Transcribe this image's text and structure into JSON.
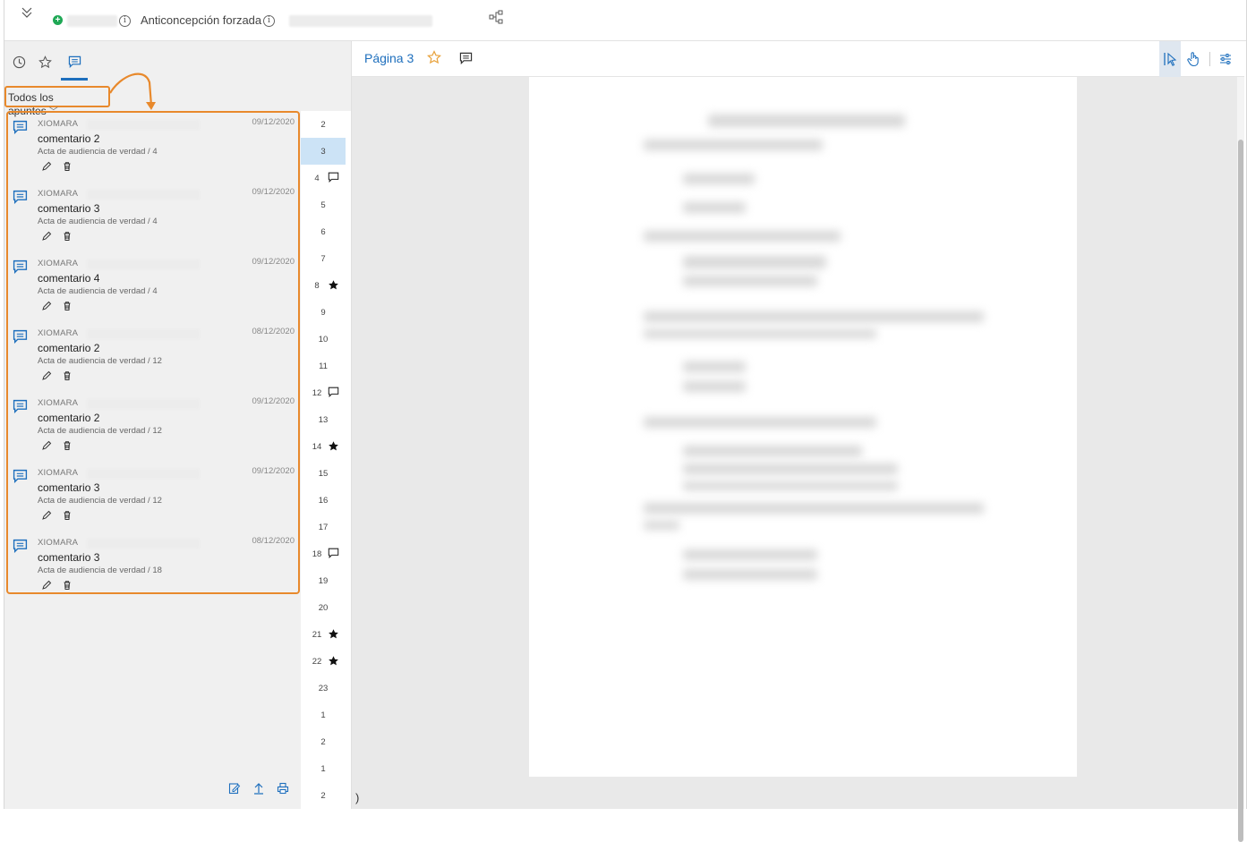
{
  "header": {
    "case_title": "Anticoncepción forzada",
    "icons": [
      "chevron-double-down-icon",
      "plus-circle-icon",
      "info-icon",
      "tree-icon"
    ],
    "colors": {
      "plus": "#1fa855",
      "accent": "#1e6fbd",
      "highlight": "#e8892c"
    }
  },
  "sidebar": {
    "tabs": [
      {
        "name": "history",
        "icon": "clock-icon"
      },
      {
        "name": "favorites",
        "icon": "star-icon"
      },
      {
        "name": "notes",
        "icon": "comment-icon",
        "active": true
      }
    ],
    "filter_label": "Todos los apuntes",
    "notes": [
      {
        "author": "XIOMARA",
        "date": "09/12/2020",
        "title": "comentario 2",
        "ref": "Acta de audiencia de verdad / 4"
      },
      {
        "author": "XIOMARA",
        "date": "09/12/2020",
        "title": "comentario 3",
        "ref": "Acta de audiencia de verdad / 4"
      },
      {
        "author": "XIOMARA",
        "date": "09/12/2020",
        "title": "comentario 4",
        "ref": "Acta de audiencia de verdad / 4"
      },
      {
        "author": "XIOMARA",
        "date": "08/12/2020",
        "title": "comentario 2",
        "ref": "Acta de audiencia de verdad / 12"
      },
      {
        "author": "XIOMARA",
        "date": "09/12/2020",
        "title": "comentario 2",
        "ref": "Acta de audiencia de verdad / 12"
      },
      {
        "author": "XIOMARA",
        "date": "09/12/2020",
        "title": "comentario 3",
        "ref": "Acta de audiencia de verdad / 12"
      },
      {
        "author": "XIOMARA",
        "date": "08/12/2020",
        "title": "comentario 3",
        "ref": "Acta de audiencia de verdad / 18"
      }
    ],
    "footer_icons": [
      "edit-note-icon",
      "export-icon",
      "print-icon"
    ]
  },
  "pages": [
    {
      "num": "2",
      "mark": ""
    },
    {
      "num": "3",
      "mark": "",
      "active": true
    },
    {
      "num": "4",
      "mark": "comment"
    },
    {
      "num": "5",
      "mark": ""
    },
    {
      "num": "6",
      "mark": ""
    },
    {
      "num": "7",
      "mark": ""
    },
    {
      "num": "8",
      "mark": "star"
    },
    {
      "num": "9",
      "mark": ""
    },
    {
      "num": "10",
      "mark": ""
    },
    {
      "num": "11",
      "mark": ""
    },
    {
      "num": "12",
      "mark": "comment"
    },
    {
      "num": "13",
      "mark": ""
    },
    {
      "num": "14",
      "mark": "star"
    },
    {
      "num": "15",
      "mark": ""
    },
    {
      "num": "16",
      "mark": ""
    },
    {
      "num": "17",
      "mark": ""
    },
    {
      "num": "18",
      "mark": "comment"
    },
    {
      "num": "19",
      "mark": ""
    },
    {
      "num": "20",
      "mark": ""
    },
    {
      "num": "21",
      "mark": "star"
    },
    {
      "num": "22",
      "mark": "star"
    },
    {
      "num": "23",
      "mark": ""
    },
    {
      "num": "1",
      "mark": ""
    },
    {
      "num": "2",
      "mark": ""
    },
    {
      "num": "1",
      "mark": ""
    },
    {
      "num": "2",
      "mark": ""
    }
  ],
  "viewer": {
    "page_label": "Página 3",
    "tools": [
      "select-pointer-icon",
      "hand-icon",
      "settings-sliders-icon"
    ],
    "stray_text": ")"
  }
}
